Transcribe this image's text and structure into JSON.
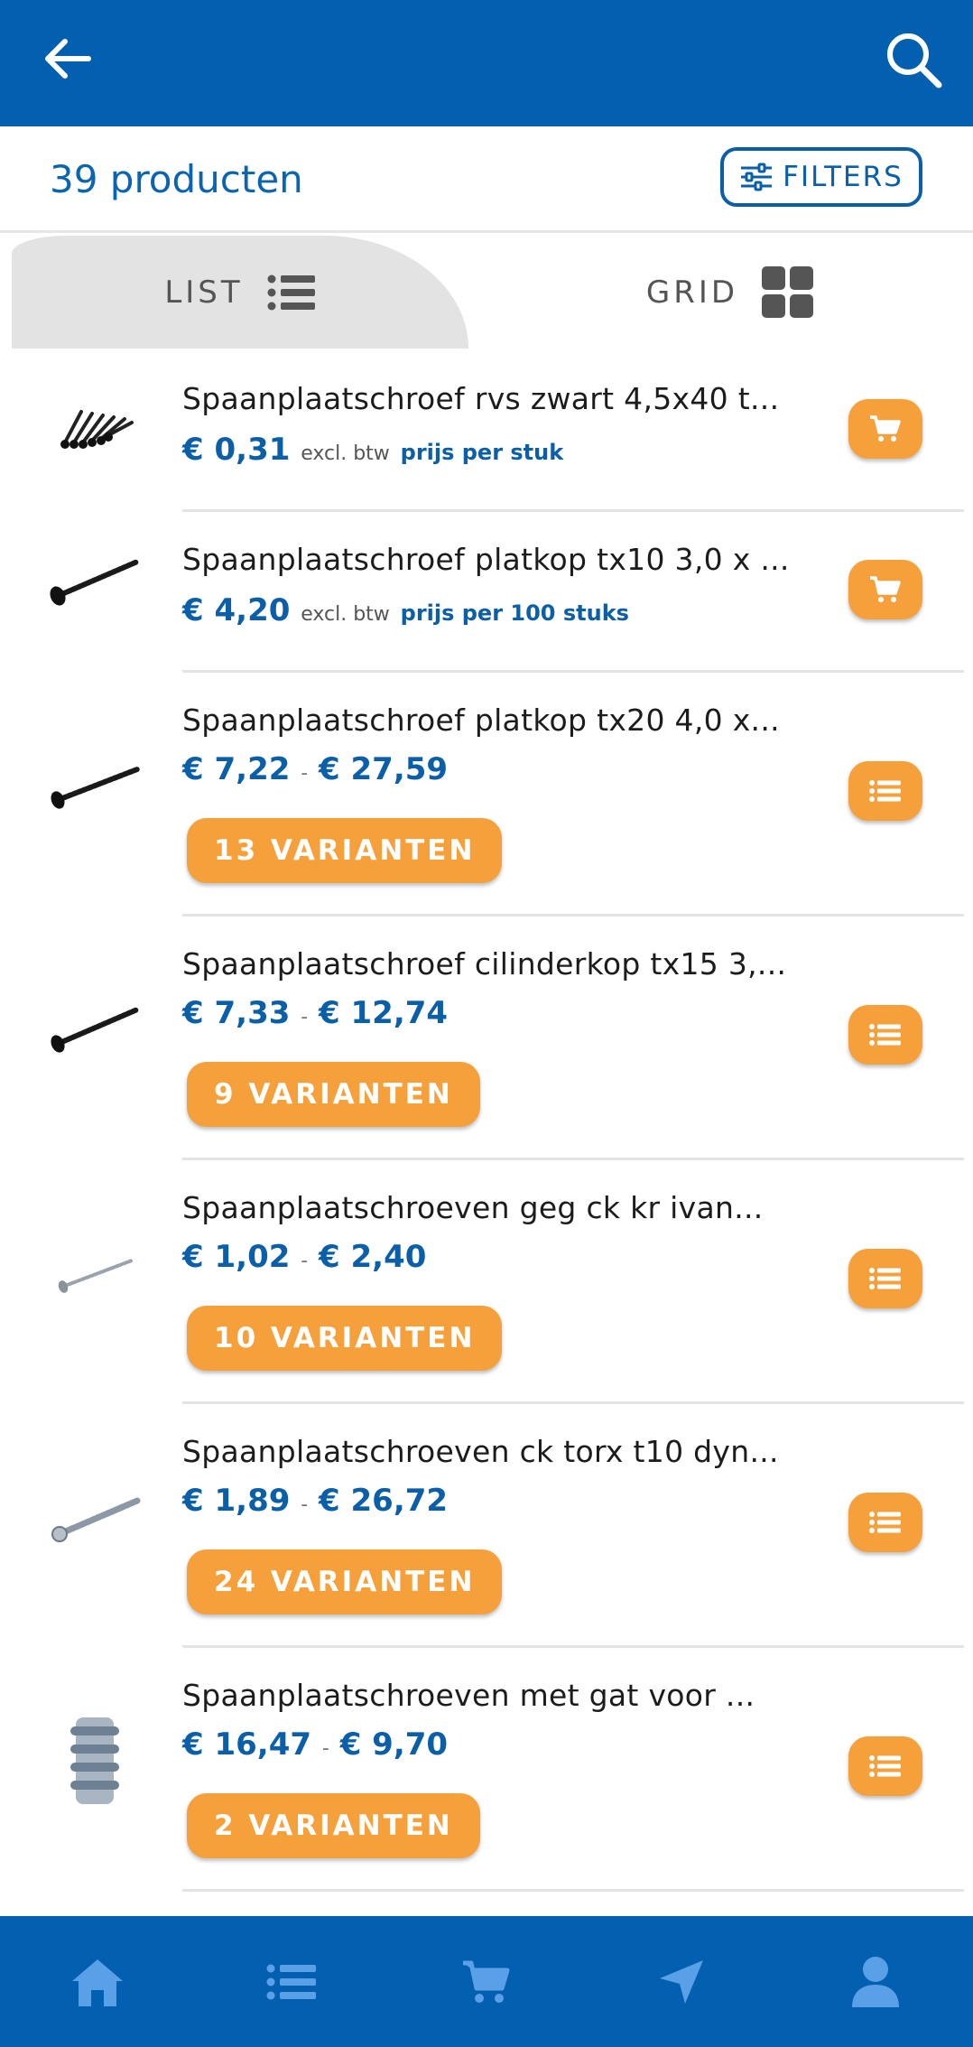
{
  "header": {
    "back_icon": "arrow-left-icon",
    "search_icon": "search-icon",
    "color": "#0360b0"
  },
  "toolbar": {
    "count_label": "39 producten",
    "filters_label": "FILTERS"
  },
  "view_tabs": {
    "list_label": "LIST",
    "grid_label": "GRID",
    "active": "LIST"
  },
  "products": [
    {
      "title": "Spaanplaatschroef rvs zwart 4,5x40 t...",
      "price": "€ 0,31",
      "excl": "excl. btw",
      "unit": "prijs per stuk",
      "action": "cart"
    },
    {
      "title": "Spaanplaatschroef platkop tx10 3,0 x ...",
      "price": "€ 4,20",
      "excl": "excl. btw",
      "unit": "prijs per 100 stuks",
      "action": "cart"
    },
    {
      "title": "Spaanplaatschroef platkop tx20 4,0 x...",
      "price_from": "€ 7,22",
      "price_to": "€ 27,59",
      "variants": "13 VARIANTEN",
      "action": "list"
    },
    {
      "title": "Spaanplaatschroef cilinderkop tx15 3,...",
      "price_from": "€ 7,33",
      "price_to": "€ 12,74",
      "variants": "9 VARIANTEN",
      "action": "list"
    },
    {
      "title": "Spaanplaatschroeven geg ck kr ivan...",
      "price_from": "€ 1,02",
      "price_to": "€ 2,40",
      "variants": "10 VARIANTEN",
      "action": "list"
    },
    {
      "title": "Spaanplaatschroeven ck torx t10 dyn...",
      "price_from": "€ 1,89",
      "price_to": "€ 26,72",
      "variants": "24 VARIANTEN",
      "action": "list"
    },
    {
      "title": "Spaanplaatschroeven met gat voor ...",
      "price_from": "€ 16,47",
      "price_to": "€ 9,70",
      "variants": "2 VARIANTEN",
      "action": "list"
    }
  ],
  "price_separator": "-",
  "bottom_nav": [
    {
      "icon": "home-icon"
    },
    {
      "icon": "list-icon"
    },
    {
      "icon": "cart-icon"
    },
    {
      "icon": "navigation-icon"
    },
    {
      "icon": "user-icon"
    }
  ],
  "colors": {
    "brand_blue": "#0360b0",
    "accent_orange": "#f6a03b"
  }
}
